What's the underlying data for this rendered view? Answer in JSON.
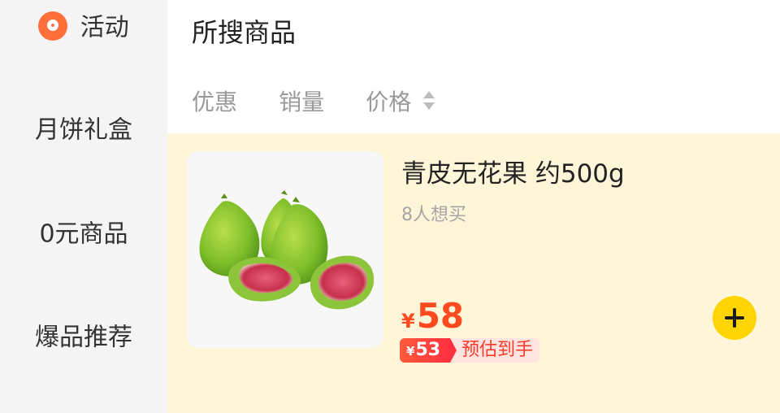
{
  "sidebar": {
    "items": [
      {
        "label": "活动",
        "icon": "location-pin-icon"
      },
      {
        "label": "月饼礼盒"
      },
      {
        "label": "0元商品"
      },
      {
        "label": "爆品推荐"
      }
    ]
  },
  "main": {
    "title": "所搜商品",
    "sort": {
      "discount_label": "优惠",
      "sales_label": "销量",
      "price_label": "价格"
    }
  },
  "product": {
    "name": "青皮无花果 约500g",
    "wants": "8人想买",
    "currency": "¥",
    "price": "58",
    "estimate_currency": "¥",
    "estimate_price": "53",
    "estimate_label": "预估到手",
    "image": "green-fig-image"
  },
  "colors": {
    "accent_orange": "#ff6f3c",
    "price_red": "#ff4a1f",
    "card_bg": "#fff6d9",
    "add_button": "#ffd400"
  }
}
